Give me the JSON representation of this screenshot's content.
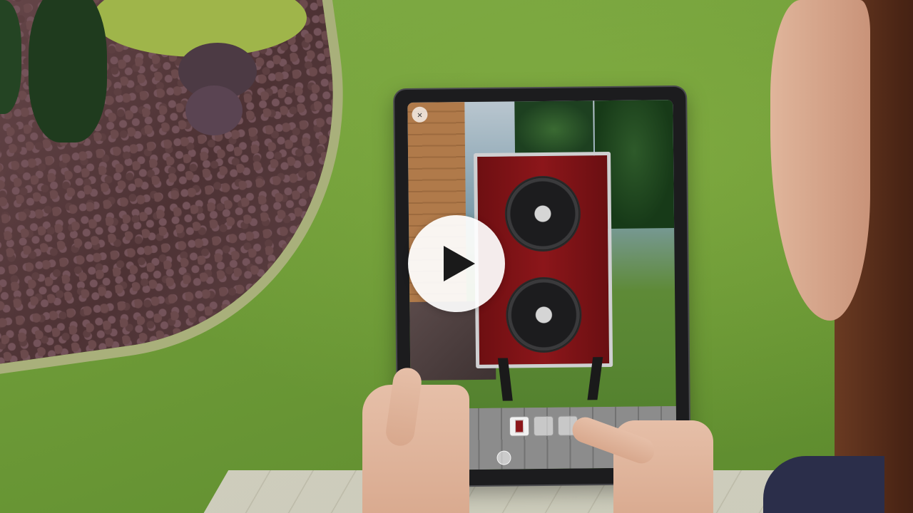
{
  "video": {
    "play_icon": "play-icon",
    "play_button_color": "#ffffff"
  },
  "ar_app": {
    "close_icon_glyph": "×",
    "unit_color": "#8c161a",
    "frame_color": "#cfcfd1"
  }
}
